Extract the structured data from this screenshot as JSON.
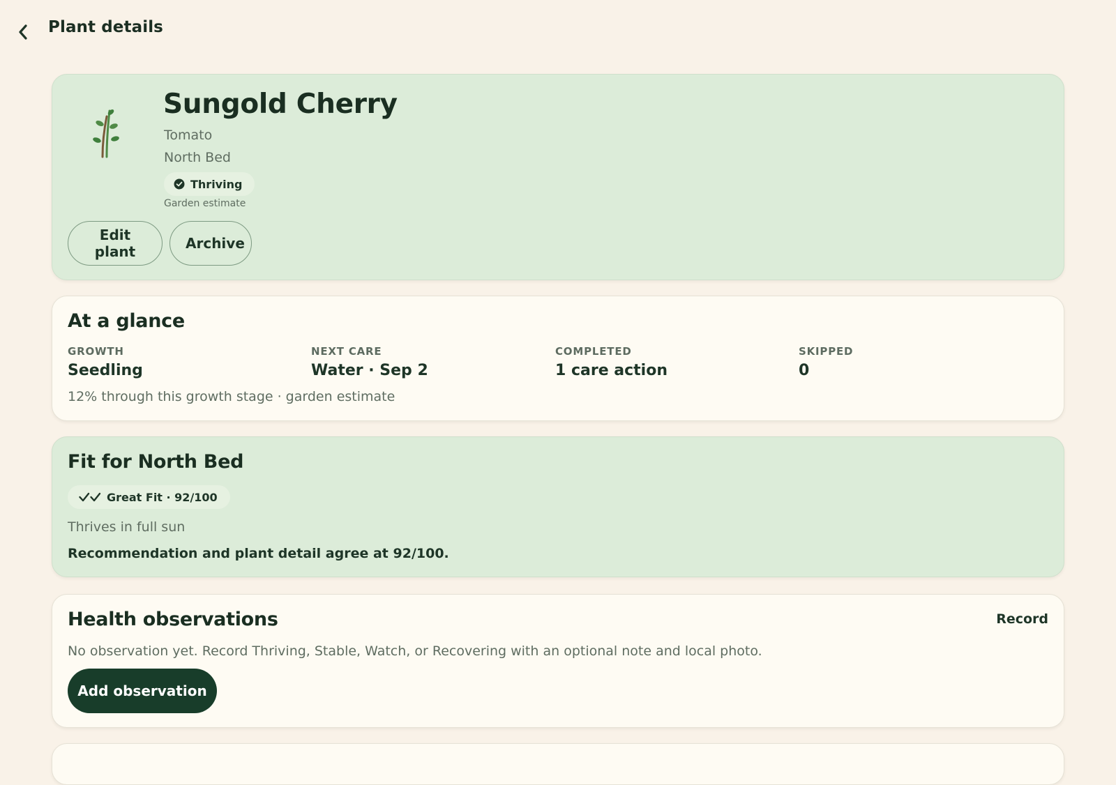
{
  "header": {
    "back_icon": "chevron-left-icon",
    "title": "Plant details"
  },
  "plant": {
    "icon": "seedling-icon",
    "name": "Sungold Cherry",
    "type": "Tomato",
    "bed": "North Bed",
    "status": {
      "icon": "check-circle-icon",
      "label": "Thriving",
      "caption": "Garden estimate"
    },
    "actions": {
      "edit_label": "Edit plant",
      "archive_label": "Archive"
    }
  },
  "glance": {
    "title": "At a glance",
    "stats": [
      {
        "label": "Growth",
        "value": "Seedling"
      },
      {
        "label": "Next care",
        "value": "Water · Sep 2"
      },
      {
        "label": "Completed",
        "value": "1 care action"
      },
      {
        "label": "Skipped",
        "value": "0"
      }
    ],
    "note": "12% through this growth stage · garden estimate"
  },
  "fit": {
    "title": "Fit for North Bed",
    "badge_icon": "double-check-icon",
    "badge": "Great Fit · 92/100",
    "description": "Thrives in full sun",
    "agreement": "Recommendation and plant detail agree at 92/100."
  },
  "health": {
    "title": "Health observations",
    "record_label": "Record",
    "empty_text": "No observation yet. Record Thriving, Stable, Watch, or Recovering with an optional note and local photo.",
    "add_label": "Add observation"
  },
  "colors": {
    "background": "#f9f2e8",
    "hero_green": "#dcecd9",
    "card_cream": "#fefbf3",
    "primary_dark_green": "#183d2a",
    "text_dark": "#1e3527",
    "text_muted": "#5f6d61"
  }
}
